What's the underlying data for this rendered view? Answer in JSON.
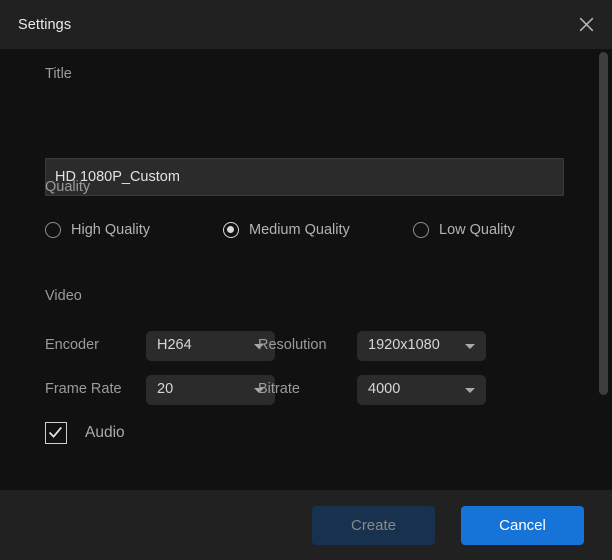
{
  "window": {
    "title": "Settings",
    "close_icon": "close-icon"
  },
  "form": {
    "title_section": {
      "label": "Title",
      "value": "HD 1080P_Custom",
      "placeholder": "HD 1080P_Custom"
    },
    "quality_section": {
      "label": "Quality",
      "selected": "Medium Quality",
      "options": [
        {
          "label": "High Quality",
          "selected": false
        },
        {
          "label": "Medium Quality",
          "selected": true
        },
        {
          "label": "Low Quality",
          "selected": false
        }
      ]
    },
    "video_section": {
      "label": "Video",
      "fields": [
        {
          "label": "Encoder",
          "value": "H264"
        },
        {
          "label": "Resolution",
          "value": "1920x1080"
        },
        {
          "label": "Frame Rate",
          "value": "20"
        },
        {
          "label": "Bitrate",
          "value": "4000"
        }
      ]
    },
    "audio_section": {
      "label": "Audio",
      "checked": true
    }
  },
  "footer": {
    "create_label": "Create",
    "cancel_label": "Cancel"
  },
  "colors": {
    "titlebar_bg": "#212121",
    "body_bg": "#111111",
    "footer_bg": "#212121",
    "input_bg": "#2b2b2b",
    "dropdown_bg": "#2b2b2b",
    "accent_primary": "#1673d8",
    "accent_muted": "#17314f",
    "label_text": "#9b9b9b",
    "value_text": "#d6d6d6",
    "scrollbar_thumb": "#3e3e3e"
  }
}
